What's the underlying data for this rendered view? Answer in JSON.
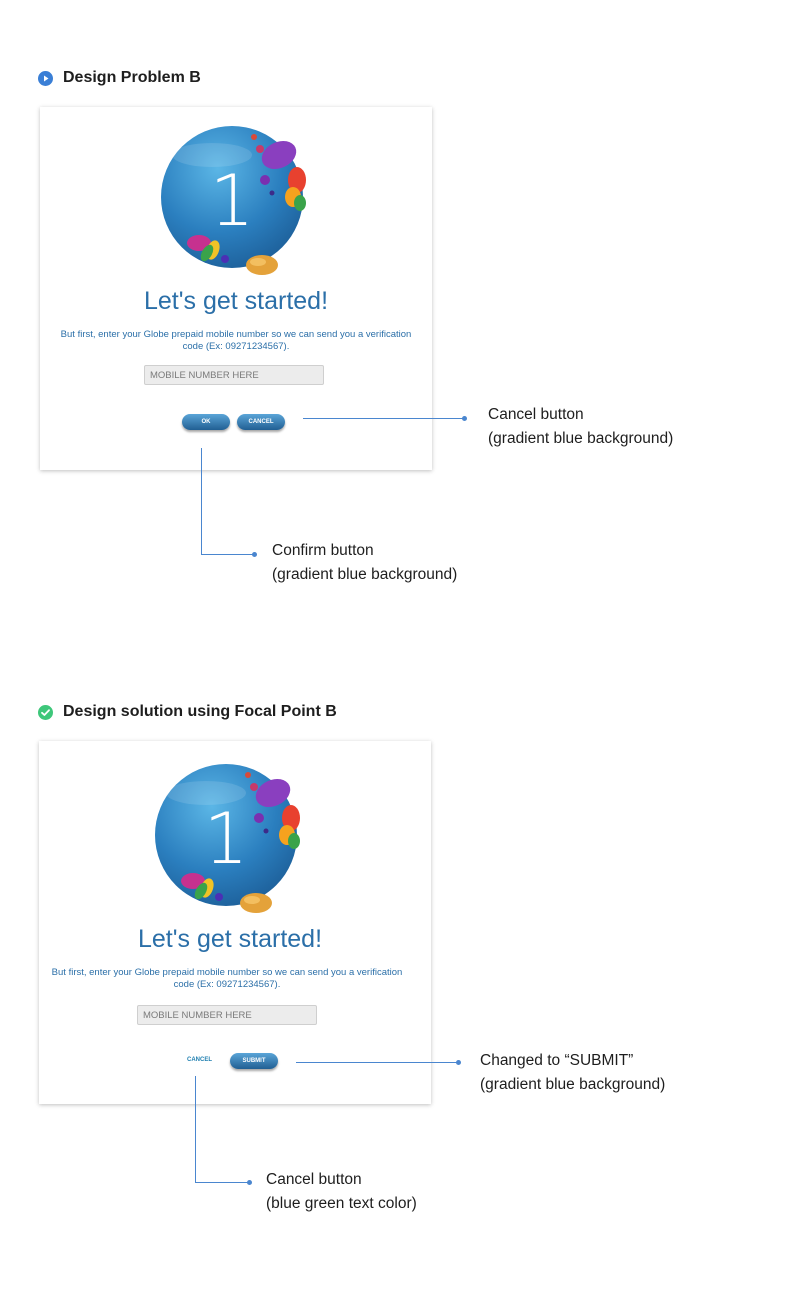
{
  "problem": {
    "section_title": "Design Problem B",
    "icon": "play-icon",
    "card": {
      "step_number": "1",
      "heading": "Let's get started!",
      "description": "But first, enter your Globe prepaid mobile number so we can send you a verification code (Ex: 09271234567).",
      "input_placeholder": "MOBILE NUMBER HERE",
      "ok_label": "OK",
      "cancel_label": "CANCEL"
    },
    "annotations": {
      "cancel": [
        "Cancel button",
        "(gradient blue background)"
      ],
      "confirm": [
        "Confirm button",
        "(gradient blue background)"
      ]
    }
  },
  "solution": {
    "section_title": "Design solution using Focal Point B",
    "icon": "check-icon",
    "card": {
      "step_number": "1",
      "heading": "Let's get started!",
      "description": "But first, enter your Globe prepaid mobile number so we can send you a verification code (Ex: 09271234567).",
      "input_placeholder": "MOBILE NUMBER HERE",
      "cancel_label": "CANCEL",
      "submit_label": "SUBMIT"
    },
    "annotations": {
      "submit": [
        "Changed to “SUBMIT”",
        "(gradient blue background)"
      ],
      "cancel": [
        "Cancel button",
        "(blue green text color)"
      ]
    }
  },
  "colors": {
    "heading_blue": "#2b6fa8",
    "annotation_line": "#4a86cf",
    "button_gradient_top": "#5aa5d8",
    "button_gradient_bottom": "#215f93",
    "text_button_blue_green": "#1f7fb0"
  }
}
